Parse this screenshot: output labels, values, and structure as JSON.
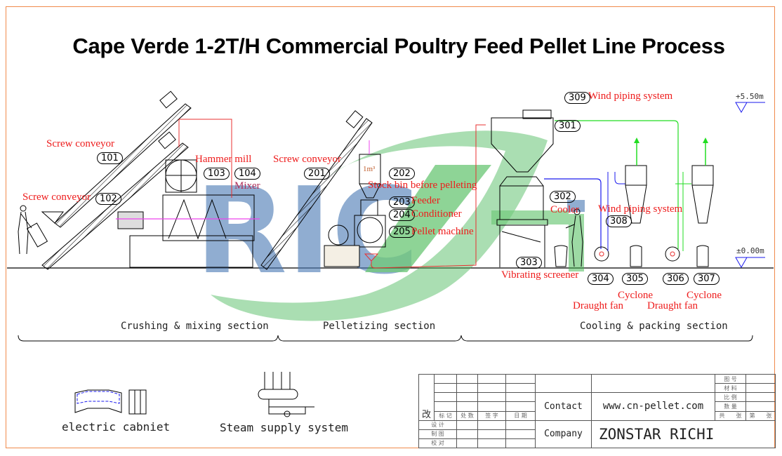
{
  "title": "Cape Verde 1-2T/H Commercial Poultry Feed Pellet Line Process",
  "watermark": {
    "text": "RICHI",
    "blue": "#4a7ab5",
    "green": "#3db54a"
  },
  "colors": {
    "label_red": "#ee1c1c",
    "frame_orange": "#f08a4b",
    "pipe_green": "#22dd22",
    "pipe_blue": "#1a1aee",
    "pipe_red": "#e83030",
    "pipe_magenta": "#ee44ee"
  },
  "equipment": [
    {
      "id": "101",
      "name": "Screw conveyor"
    },
    {
      "id": "102",
      "name": "Screw conveyor"
    },
    {
      "id": "103",
      "name": "Hammer mill"
    },
    {
      "id": "104",
      "name": "Mixer"
    },
    {
      "id": "201",
      "name": "Screw conveyor"
    },
    {
      "id": "202",
      "name": "Stock bin before pelleting",
      "note": "1m³"
    },
    {
      "id": "203",
      "name": "Feeder"
    },
    {
      "id": "204",
      "name": "Conditioner"
    },
    {
      "id": "205",
      "name": "Pellet machine"
    },
    {
      "id": "301",
      "name": ""
    },
    {
      "id": "302",
      "name": "Cooler"
    },
    {
      "id": "303",
      "name": "Vibrating screener"
    },
    {
      "id": "304",
      "name": "Draught fan"
    },
    {
      "id": "305",
      "name": "Cyclone"
    },
    {
      "id": "306",
      "name": "Draught fan"
    },
    {
      "id": "307",
      "name": "Cyclone"
    },
    {
      "id": "308",
      "name": "Wind piping system"
    },
    {
      "id": "309",
      "name": "Wind piping system"
    }
  ],
  "elevations": {
    "top": "+5.50m",
    "ground": "±0.00m"
  },
  "sections": [
    "Crushing & mixing section",
    "Pelletizing section",
    "Cooling & packing section"
  ],
  "legend": {
    "electric_cabinet": "electric cabniet",
    "steam_supply": "Steam supply system"
  },
  "title_block": {
    "revision_char": "改",
    "rev_headers": [
      "标 记",
      "处 数",
      "签 字",
      "日 期"
    ],
    "roles": [
      "设 计",
      "制 图",
      "校 对"
    ],
    "contact_label": "Contact",
    "contact_value": "www.cn-pellet.com",
    "company_label": "Company",
    "company_value": "ZONSTAR RICHI",
    "right_fields": [
      "图 号",
      "材 料",
      "比 例",
      "数 量"
    ],
    "sheet_total": "共　　张",
    "sheet_no": "第　　张"
  }
}
